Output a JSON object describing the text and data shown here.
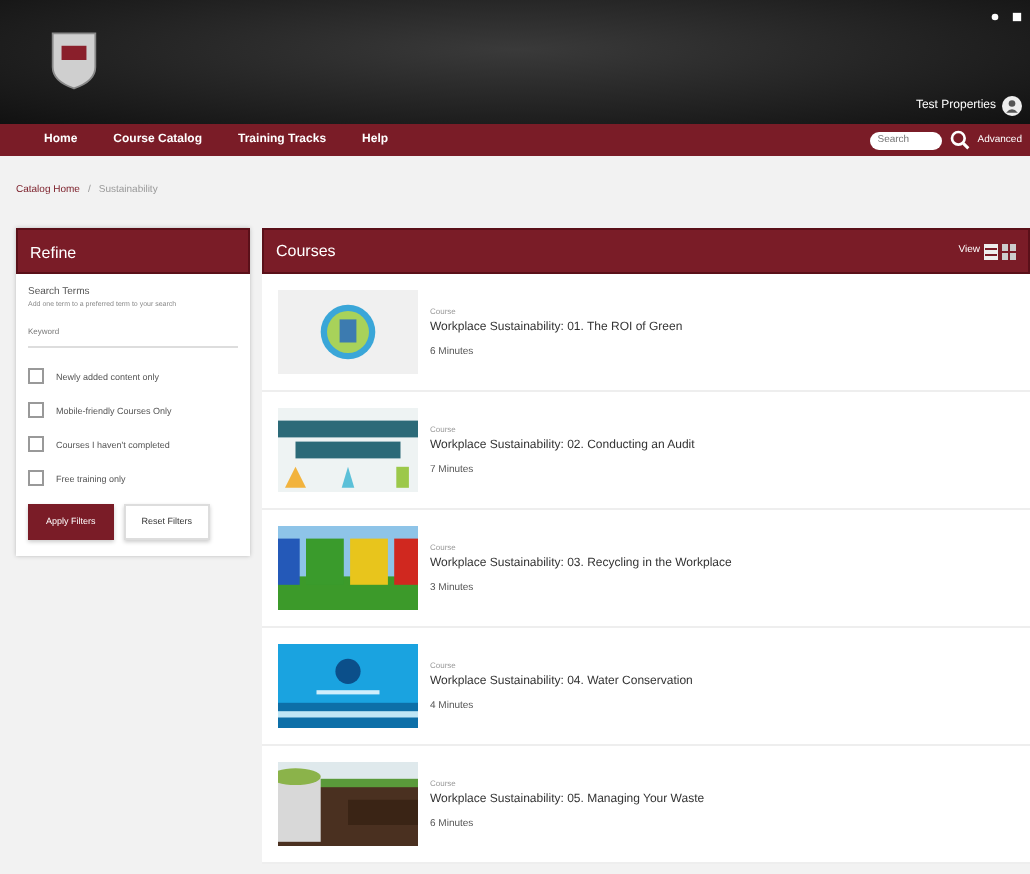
{
  "header": {
    "user_name": "Test Properties"
  },
  "nav": {
    "items": [
      "Home",
      "Course Catalog",
      "Training Tracks",
      "Help"
    ],
    "search": {
      "placeholder": "Search"
    },
    "advanced_link": "Advanced"
  },
  "breadcrumb": {
    "items": [
      "Catalog Home",
      "Sustainability"
    ],
    "separator": "/"
  },
  "refine": {
    "title": "Refine",
    "search_label": "Search Terms",
    "search_hint": "Add one term to a preferred term to your search",
    "search_field": {
      "placeholder": "Keyword"
    },
    "filters": [
      {
        "label": "Newly added content only",
        "checked": false
      },
      {
        "label": "Mobile-friendly Courses Only",
        "checked": false
      },
      {
        "label": "Courses I haven't completed",
        "checked": false
      },
      {
        "label": "Free training only",
        "checked": false
      }
    ],
    "buttons": [
      "Apply Filters",
      "Reset Filters"
    ]
  },
  "courses": {
    "title": "Courses",
    "view_label": "View",
    "items": [
      {
        "type": "Course",
        "title": "Workplace Sustainability: 01. The ROI of Green",
        "duration": "6 Minutes",
        "kind": "picture"
      },
      {
        "type": "Course",
        "title": "Workplace Sustainability: 02. Conducting an Audit",
        "duration": "7 Minutes",
        "kind": "picture"
      },
      {
        "type": "Course",
        "title": "Workplace Sustainability: 03. Recycling in the Workplace",
        "duration": "3 Minutes",
        "kind": "picture"
      },
      {
        "type": "Course",
        "title": "Workplace Sustainability: 04. Water Conservation",
        "duration": "4 Minutes",
        "kind": "picture"
      },
      {
        "type": "Course",
        "title": "Workplace Sustainability: 05. Managing Your Waste",
        "duration": "6 Minutes",
        "kind": "picture"
      }
    ]
  }
}
